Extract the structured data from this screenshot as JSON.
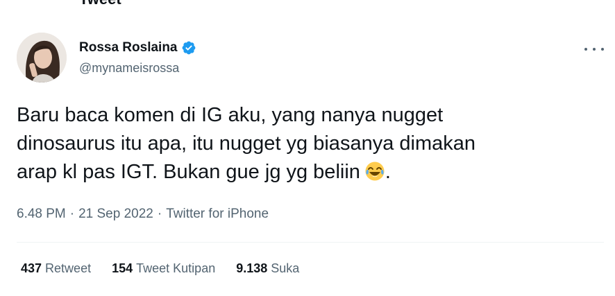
{
  "top_clip_text": "Tweet",
  "author": {
    "display_name": "Rossa Roslaina",
    "handle": "@mynameisrossa",
    "verified": true,
    "verified_color": "#1d9bf0"
  },
  "tweet": {
    "text": "Baru baca komen di IG aku, yang nanya nugget\ndinosaurus itu apa, itu nugget yg biasanya dimakan\narap kl pas IGT. Bukan gue jg yg beliin",
    "text_suffix": ".",
    "emoji": "face-with-tears-of-joy"
  },
  "meta": {
    "time": "6.48 PM",
    "date": "21 Sep 2022",
    "source": "Twitter for iPhone",
    "separator": "·"
  },
  "stats": {
    "retweets_count": "437",
    "retweets_label": "Retweet",
    "quotes_count": "154",
    "quotes_label": "Tweet Kutipan",
    "likes_count": "9.138",
    "likes_label": "Suka"
  },
  "icons": {
    "more": "more-icon",
    "verified": "verified-badge-icon"
  }
}
